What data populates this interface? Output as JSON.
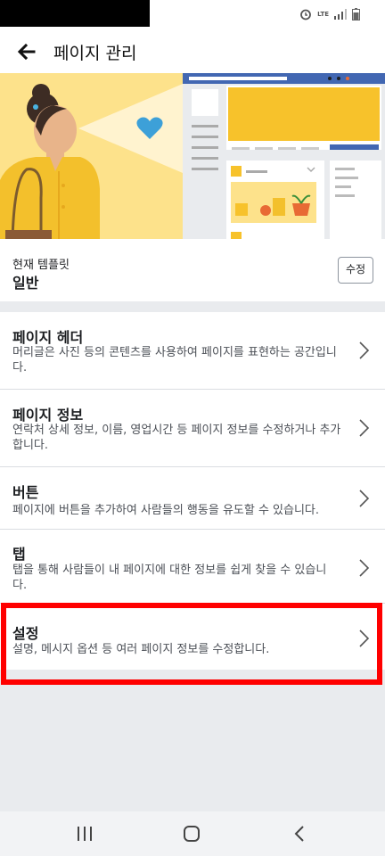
{
  "status": {
    "icons": [
      "alarm-icon",
      "lte-icon",
      "signal-icon",
      "battery-icon"
    ],
    "lte": "LTE"
  },
  "header": {
    "title": "페이지 관리"
  },
  "template": {
    "label": "현재 템플릿",
    "value": "일반",
    "edit_label": "수정"
  },
  "items": [
    {
      "title": "페이지 헤더",
      "desc": "머리글은 사진 등의 콘텐츠를 사용하여 페이지를 표현하는 공간입니다."
    },
    {
      "title": "페이지 정보",
      "desc": "연락처 상세 정보, 이름, 영업시간 등 페이지 정보를 수정하거나 추가합니다."
    },
    {
      "title": "버튼",
      "desc": "페이지에 버튼을 추가하여 사람들의 행동을 유도할 수 있습니다."
    },
    {
      "title": "탭",
      "desc": "탭을 통해 사람들이 내 페이지에 대한 정보를 쉽게 찾을 수 있습니다."
    },
    {
      "title": "설정",
      "desc": "설명, 메시지 옵션 등 여러 페이지 정보를 수정합니다."
    }
  ],
  "colors": {
    "highlight": "#ff0000",
    "fb_blue": "#4267b2",
    "hero_yellow": "#f7c22b"
  }
}
